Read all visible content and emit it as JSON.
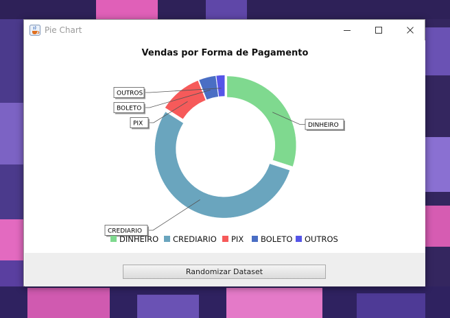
{
  "window": {
    "title": "Pie Chart",
    "app_icon": "java-coffee-cup-icon"
  },
  "controls": {
    "minimize_icon": "minimize-icon",
    "maximize_icon": "maximize-icon",
    "close_icon": "close-icon"
  },
  "actions": {
    "randomize_label": "Randomizar Dataset"
  },
  "chart_data": {
    "type": "pie",
    "variant": "donut",
    "title": "Vendas por Forma de Pagamento",
    "categories": [
      "DINHEIRO",
      "CREDIARIO",
      "PIX",
      "BOLETO",
      "OUTROS"
    ],
    "values": [
      30,
      54,
      10,
      4,
      2
    ],
    "colors": [
      "#7fd98f",
      "#6aa5be",
      "#f65a5a",
      "#4a6ec4",
      "#5555e8"
    ],
    "legend_position": "bottom",
    "labels_as_callouts": true
  }
}
